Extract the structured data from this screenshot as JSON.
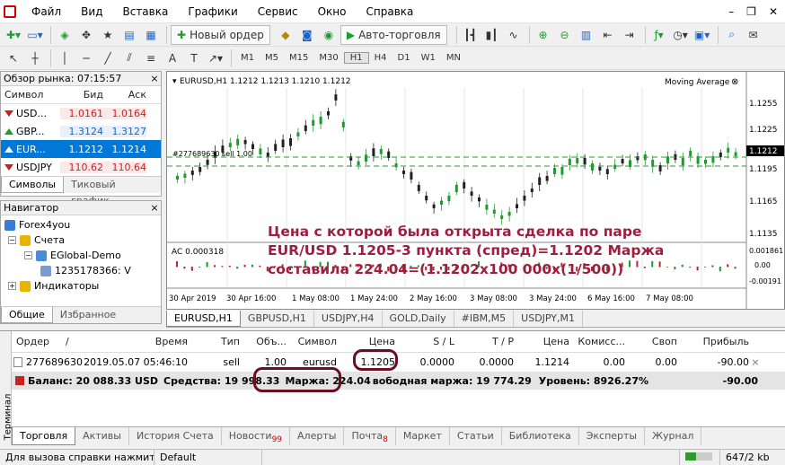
{
  "menu": [
    "Файл",
    "Вид",
    "Вставка",
    "Графики",
    "Сервис",
    "Окно",
    "Справка"
  ],
  "toolbar": {
    "new_order": "Новый ордер",
    "autotrading": "Авто-торговля",
    "timeframes": [
      "M1",
      "M5",
      "M15",
      "M30",
      "H1",
      "H4",
      "D1",
      "W1",
      "MN"
    ]
  },
  "market_watch": {
    "title": "Обзор рынка: 07:15:57",
    "col_symbol": "Символ",
    "col_bid": "Бид",
    "col_ask": "Аск",
    "rows": [
      {
        "symbol": "USD...",
        "bid": "1.0161",
        "ask": "1.0164",
        "dir": "down"
      },
      {
        "symbol": "GBP...",
        "bid": "1.3124",
        "ask": "1.3127",
        "dir": "up"
      },
      {
        "symbol": "EUR...",
        "bid": "1.1212",
        "ask": "1.1214",
        "dir": "up"
      },
      {
        "symbol": "USDJPY",
        "bid": "110.62",
        "ask": "110.64",
        "dir": "down"
      }
    ],
    "tabs": [
      "Символы",
      "Тиковый график"
    ]
  },
  "navigator": {
    "title": "Навигатор",
    "items": [
      "Forex4you",
      "Счета",
      "EGlobal-Demo",
      "1235178366: V",
      "Индикаторы"
    ],
    "tabs": [
      "Общие",
      "Избранное"
    ]
  },
  "chart": {
    "header": "EURUSD,H1  1.1212 1.1213 1.1210 1.1212",
    "indicator_name": "Moving Average",
    "order_label": "#277689630 sell 1.00",
    "price_labels": [
      "1.1255",
      "1.1225",
      "1.1212",
      "1.1195",
      "1.1165",
      "1.1135"
    ],
    "current_price": "1.1212",
    "osc_label": "AC 0.000318",
    "osc_labels": [
      "0.001861",
      "0.00",
      "-0.00191"
    ],
    "dates": [
      "30 Apr 2019",
      "30 Apr 16:00",
      "1 May 08:00",
      "1 May 24:00",
      "2 May 16:00",
      "3 May 08:00",
      "3 May 24:00",
      "6 May 16:00",
      "7 May 08:00"
    ],
    "tabs": [
      "EURUSD,H1",
      "GBPUSD,H1",
      "USDJPY,H4",
      "GOLD,Daily",
      "#IBM,M5",
      "USDJPY,M1"
    ]
  },
  "annotation": {
    "line1": "Цена с которой была открыта сделка по паре",
    "line2": "EUR/USD 1.1205-3 пункта (спред)=1.1202 Маржа",
    "line3": "составила 224.04=(1.1202x100 000x(1/500))"
  },
  "terminal": {
    "side_label": "Терминал",
    "columns": [
      "Ордер",
      "/",
      "Время",
      "Тип",
      "Объ...",
      "Символ",
      "Цена",
      "S / L",
      "T / P",
      "Цена",
      "Комисс...",
      "Своп",
      "Прибыль"
    ],
    "order": {
      "id": "277689630",
      "time": "2019.05.07 05:46:10",
      "type": "sell",
      "volume": "1.00",
      "symbol": "eurusd",
      "open_price": "1.1205",
      "sl": "0.0000",
      "tp": "0.0000",
      "price": "1.1214",
      "commission": "0.00",
      "swap": "0.00",
      "profit": "-90.00",
      "close": "×"
    },
    "balance": {
      "balance": "Баланс: 20 088.33 USD",
      "equity": "Средства: 19 998.33",
      "margin": "Маржа: 224.04",
      "free": "вободная маржа: 19 774.29",
      "level": "Уровень: 8926.27%",
      "profit": "-90.00"
    },
    "tabs": [
      {
        "label": "Торговля",
        "badge": ""
      },
      {
        "label": "Активы",
        "badge": ""
      },
      {
        "label": "История Счета",
        "badge": ""
      },
      {
        "label": "Новости",
        "badge": "99"
      },
      {
        "label": "Алерты",
        "badge": ""
      },
      {
        "label": "Почта",
        "badge": "8"
      },
      {
        "label": "Маркет",
        "badge": ""
      },
      {
        "label": "Статьи",
        "badge": ""
      },
      {
        "label": "Библиотека",
        "badge": ""
      },
      {
        "label": "Эксперты",
        "badge": ""
      },
      {
        "label": "Журнал",
        "badge": ""
      }
    ]
  },
  "status": {
    "help": "Для вызова справки нажмите F",
    "profile": "Default",
    "traffic": "647/2 kb"
  },
  "colors": {
    "bull": "#1e9b2e",
    "bear": "#000000",
    "select": "#0078d7",
    "annotation": "#9c1f3f",
    "highlight": "#6b0e22"
  }
}
